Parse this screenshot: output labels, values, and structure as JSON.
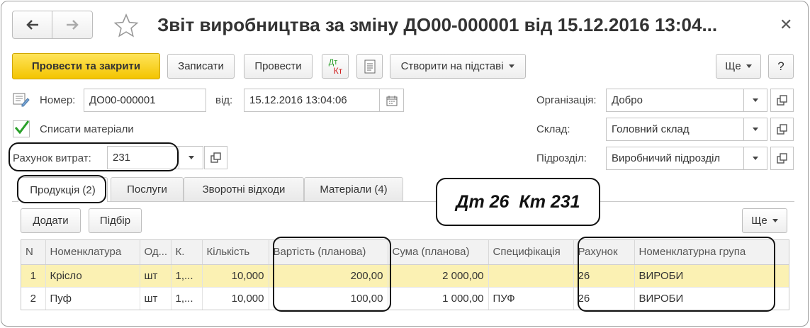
{
  "window": {
    "title": "Звіт виробництва за зміну ДО00-000001 від 15.12.2016 13:04..."
  },
  "toolbar": {
    "post_close": "Провести та закрити",
    "save": "Записати",
    "post": "Провести",
    "dt_label": "Дт",
    "kt_label": "Кт",
    "create_based": "Створити на підставі",
    "more": "Ще",
    "help": "?"
  },
  "header": {
    "number_label": "Номер:",
    "number_value": "ДО00-000001",
    "date_label": "від:",
    "date_value": "15.12.2016 13:04:06",
    "write_off_label": "Списати матеріали",
    "cost_account_label": "Рахунок витрат:",
    "cost_account_value": "231",
    "org_label": "Організація:",
    "org_value": "Добро",
    "warehouse_label": "Склад:",
    "warehouse_value": "Головний склад",
    "division_label": "Підрозділ:",
    "division_value": "Виробничий підрозділ"
  },
  "tabs": [
    {
      "label": "Продукція (2)"
    },
    {
      "label": "Послуги"
    },
    {
      "label": "Зворотні відходи"
    },
    {
      "label": "Матеріали (4)"
    }
  ],
  "annotation": "Дт 26  Кт 231",
  "table_toolbar": {
    "add": "Додати",
    "pick": "Підбір",
    "more": "Ще"
  },
  "table": {
    "columns": [
      "N",
      "Номенклатура",
      "Од...",
      "К.",
      "Кількість",
      "Вартість (планова)",
      "Сума (планова)",
      "Специфікація",
      "Рахунок",
      "Номенклатурна група"
    ],
    "rows": [
      {
        "n": "1",
        "item": "Крісло",
        "unit": "шт",
        "k": "1,...",
        "qty": "10,000",
        "cost": "200,00",
        "sum": "2 000,00",
        "spec": "",
        "account": "26",
        "group": "ВИРОБИ"
      },
      {
        "n": "2",
        "item": "Пуф",
        "unit": "шт",
        "k": "1,...",
        "qty": "10,000",
        "cost": "100,00",
        "sum": "1 000,00",
        "spec": "ПУФ",
        "account": "26",
        "group": "ВИРОБИ"
      }
    ]
  }
}
